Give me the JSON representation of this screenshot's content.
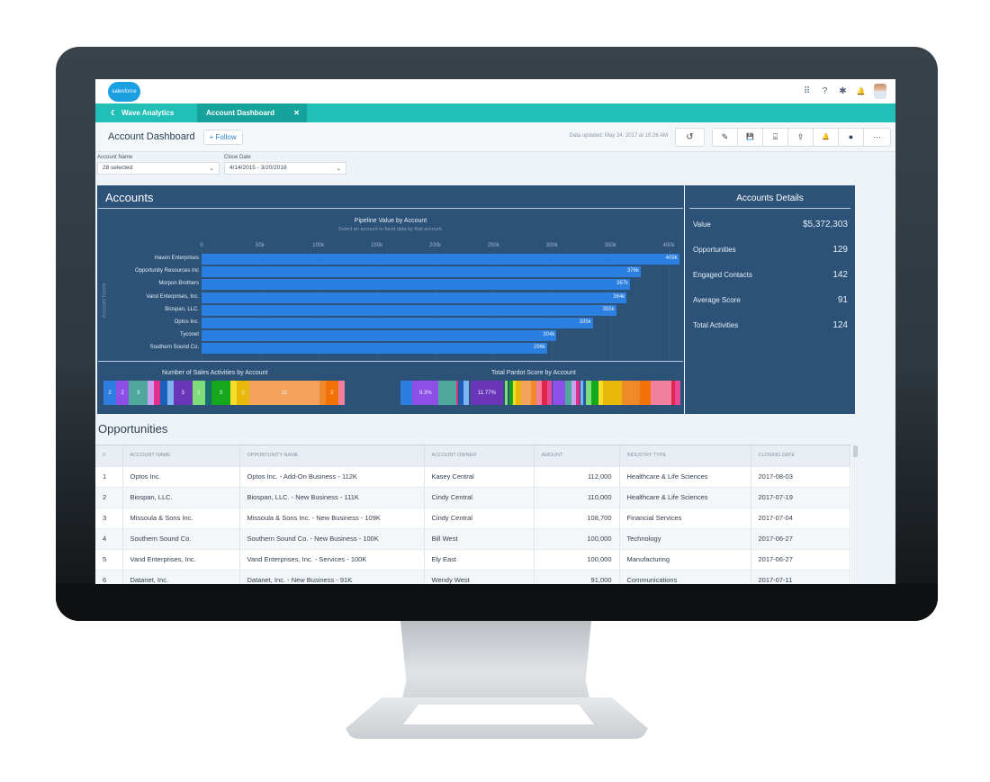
{
  "global_header": {
    "logo_text": "salesforce",
    "icons": [
      "app-launcher-icon",
      "help-icon",
      "gear-icon",
      "bell-icon",
      "avatar"
    ],
    "icon_glyphs": [
      "⠿",
      "?",
      "✱",
      "🔔"
    ]
  },
  "nav": {
    "app_name": "Wave Analytics",
    "app_icon_glyph": "☾",
    "tab_label": "Account Dashboard",
    "tab_close_glyph": "✕"
  },
  "page_header": {
    "title": "Account Dashboard",
    "follow_label": "+ Follow",
    "data_updated": "Data updated: May 24, 2017 at 10:26 AM",
    "undo_glyph": "↺",
    "toolbar": [
      {
        "name": "edit-icon",
        "glyph": "✎"
      },
      {
        "name": "save-icon",
        "glyph": "💾"
      },
      {
        "name": "present-icon",
        "glyph": "⌸"
      },
      {
        "name": "share-icon",
        "glyph": "⇪"
      },
      {
        "name": "notify-icon",
        "glyph": "🔔"
      },
      {
        "name": "comment-icon",
        "glyph": "●"
      },
      {
        "name": "more-icon",
        "glyph": "···"
      }
    ]
  },
  "filters": {
    "account_name": {
      "label": "Account Name",
      "value": "28 selected"
    },
    "close_date": {
      "label": "Close Date",
      "value": "4/14/2015 - 3/20/2018"
    },
    "chevron": "⌄"
  },
  "accounts": {
    "title": "Accounts",
    "pipeline_chart": {
      "title": "Pipeline Value by Account",
      "subtitle": "Select an account to facet data by that account.",
      "y_axis_title": "Account Name"
    },
    "sales_activities_title": "Number of Sales Activities by Account",
    "pardot_title": "Total Pardot Score by Account"
  },
  "chart_data": [
    {
      "type": "bar",
      "orientation": "horizontal",
      "title": "Pipeline Value by Account",
      "subtitle": "Select an account to facet data by that account.",
      "ylabel": "Account Name",
      "xlabel": "",
      "xlim": [
        0,
        400000
      ],
      "x_ticks": [
        "0",
        "50k",
        "100k",
        "150k",
        "200k",
        "250k",
        "300k",
        "350k",
        "400k"
      ],
      "categories": [
        "Haven Enterprises",
        "Opportunity Resources Inc",
        "Morpon Brothers",
        "Vand Enterprises, Inc.",
        "Biospan, LLC.",
        "Optos Inc.",
        "Tyconet",
        "Southern Sound Co."
      ],
      "values": [
        409000,
        376000,
        367000,
        364000,
        355000,
        335000,
        304000,
        296000
      ],
      "data_labels": [
        "409k",
        "376k",
        "367k",
        "364k",
        "355k",
        "335k",
        "304k",
        "296k"
      ],
      "color": "#2b7fe0"
    },
    {
      "type": "bar",
      "orientation": "stacked-horizontal",
      "title": "Number of Sales Activities by Account",
      "segments": [
        {
          "value": 2,
          "label": "2",
          "color": "#2e7de0"
        },
        {
          "value": 2,
          "label": "2",
          "color": "#8d4fe8"
        },
        {
          "value": 3,
          "label": "3",
          "color": "#4ea89e"
        },
        {
          "value": 1,
          "label": "",
          "color": "#c9a2f2"
        },
        {
          "value": 1,
          "label": "",
          "color": "#e0308c"
        },
        {
          "value": 1,
          "label": "",
          "color": "#1b5fb8"
        },
        {
          "value": 1,
          "label": "",
          "color": "#7fb2f0"
        },
        {
          "value": 3,
          "label": "3",
          "color": "#6a35b8"
        },
        {
          "value": 2,
          "label": "2",
          "color": "#7edc79"
        },
        {
          "value": 1,
          "label": "",
          "color": "#166e6e"
        },
        {
          "value": 3,
          "label": "3",
          "color": "#16a81c"
        },
        {
          "value": 1,
          "label": "",
          "color": "#f7de2c"
        },
        {
          "value": 2,
          "label": "2",
          "color": "#e8b90a"
        },
        {
          "value": 11,
          "label": "11",
          "color": "#f4a35c"
        },
        {
          "value": 1,
          "label": "",
          "color": "#ef8a2b"
        },
        {
          "value": 2,
          "label": "2",
          "color": "#f27207"
        },
        {
          "value": 1,
          "label": "",
          "color": "#f07fa0"
        }
      ]
    },
    {
      "type": "bar",
      "orientation": "stacked-horizontal",
      "title": "Total Pardot Score by Account",
      "segments": [
        {
          "value": 4.3,
          "label": "",
          "color": "#2e7de0"
        },
        {
          "value": 9.3,
          "label": "9.3%",
          "color": "#8d4fe8"
        },
        {
          "value": 6.2,
          "label": "",
          "color": "#4ea89e"
        },
        {
          "value": 0.6,
          "label": "",
          "color": "#e0308c"
        },
        {
          "value": 0.5,
          "label": "",
          "color": "#2c5278"
        },
        {
          "value": 1.7,
          "label": "",
          "color": "#1b5fb8"
        },
        {
          "value": 1.7,
          "label": "",
          "color": "#7fb2f0"
        },
        {
          "value": 0.6,
          "label": "",
          "color": "#2c5278"
        },
        {
          "value": 11.77,
          "label": "11.77%",
          "color": "#6a35b8"
        },
        {
          "value": 0.6,
          "label": "",
          "color": "#2c5278"
        },
        {
          "value": 0.9,
          "label": "",
          "color": "#7edc79"
        },
        {
          "value": 0.6,
          "label": "",
          "color": "#2c5278"
        },
        {
          "value": 1.3,
          "label": "",
          "color": "#16a81c"
        },
        {
          "value": 1.1,
          "label": "",
          "color": "#f7de2c"
        },
        {
          "value": 1.9,
          "label": "",
          "color": "#e8b90a"
        },
        {
          "value": 3.4,
          "label": "",
          "color": "#f4a35c"
        },
        {
          "value": 2.0,
          "label": "",
          "color": "#ef8a2b"
        },
        {
          "value": 1.9,
          "label": "",
          "color": "#f07fa0"
        },
        {
          "value": 1.9,
          "label": "",
          "color": "#e2264a"
        },
        {
          "value": 1.7,
          "label": "",
          "color": "#e84a9a"
        },
        {
          "value": 0.4,
          "label": "",
          "color": "#2c5278"
        },
        {
          "value": 4.3,
          "label": "",
          "color": "#8d4fe8"
        },
        {
          "value": 2.2,
          "label": "",
          "color": "#4ea89e"
        },
        {
          "value": 1.7,
          "label": "",
          "color": "#c9a2f2"
        },
        {
          "value": 1.3,
          "label": "",
          "color": "#e0308c"
        },
        {
          "value": 0.4,
          "label": "",
          "color": "#2c5278"
        },
        {
          "value": 0.9,
          "label": "",
          "color": "#7fb2f0"
        },
        {
          "value": 0.6,
          "label": "",
          "color": "#1b5fb8"
        },
        {
          "value": 0.4,
          "label": "",
          "color": "#2c5278"
        },
        {
          "value": 1.7,
          "label": "",
          "color": "#7edc79"
        },
        {
          "value": 2.6,
          "label": "",
          "color": "#16a81c"
        },
        {
          "value": 1.7,
          "label": "",
          "color": "#f7de2c"
        },
        {
          "value": 6.8,
          "label": "",
          "color": "#e8b90a"
        },
        {
          "value": 6.4,
          "label": "",
          "color": "#ef8a2b"
        },
        {
          "value": 3.8,
          "label": "",
          "color": "#f27207"
        },
        {
          "value": 7.3,
          "label": "",
          "color": "#f07fa0"
        },
        {
          "value": 1.4,
          "label": "",
          "color": "#e2264a"
        },
        {
          "value": 1.9,
          "label": "",
          "color": "#e84a9a"
        }
      ]
    }
  ],
  "details": {
    "title": "Accounts Details",
    "rows": [
      {
        "label": "Value",
        "value": "$5,372,303"
      },
      {
        "label": "Opportunities",
        "value": "129"
      },
      {
        "label": "Engaged Contacts",
        "value": "142"
      },
      {
        "label": "Average Score",
        "value": "91"
      },
      {
        "label": "Total Activities",
        "value": "124"
      }
    ]
  },
  "opportunities": {
    "title": "Opportunities",
    "columns": [
      "#",
      "ACCOUNT NAME",
      "OPPORTUNITY NAME",
      "ACCOUNT OWNER",
      "AMOUNT",
      "INDUSTRY TYPE",
      "CLOSING DATE"
    ],
    "rows": [
      [
        "1",
        "Optos Inc.",
        "Optos Inc. - Add-On Business - 112K",
        "Kasey Central",
        "112,000",
        "Healthcare & Life Sciences",
        "2017-08-03"
      ],
      [
        "2",
        "Biospan, LLC.",
        "Biospan, LLC. - New Business - 111K",
        "Cindy Central",
        "110,000",
        "Healthcare & Life Sciences",
        "2017-07-19"
      ],
      [
        "3",
        "Missoula & Sons Inc.",
        "Missoula & Sons Inc. - New Business - 109K",
        "Cindy Central",
        "108,700",
        "Financial Services",
        "2017-07-04"
      ],
      [
        "4",
        "Southern Sound Co.",
        "Southern Sound Co. - New Business - 100K",
        "Bill West",
        "100,000",
        "Technology",
        "2017-06-27"
      ],
      [
        "5",
        "Vand Enterprises, Inc.",
        "Vand Enterprises, Inc. - Services - 100K",
        "Ely East",
        "100,000",
        "Manufacturing",
        "2017-06-27"
      ],
      [
        "6",
        "Datanet, Inc.",
        "Datanet, Inc. - New Business - 91K",
        "Wendy West",
        "91,000",
        "Communications",
        "2017-07-11"
      ]
    ]
  },
  "colors": {
    "brand_teal": "#21bfb6",
    "panel_navy": "#2c5278",
    "bar_blue": "#2b7fe0",
    "link_blue": "#2e84d0"
  }
}
